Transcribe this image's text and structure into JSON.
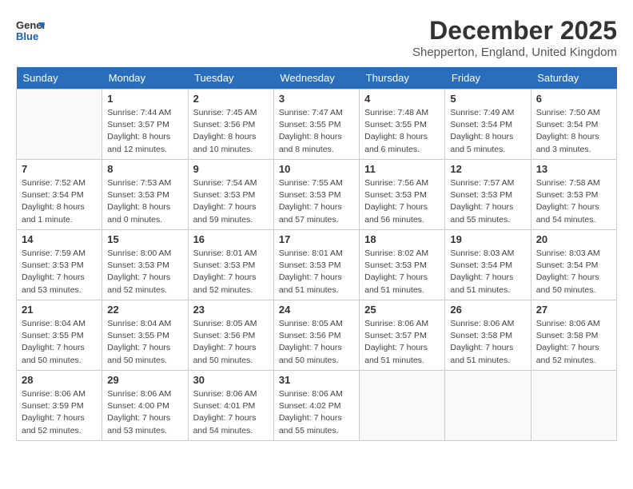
{
  "logo": {
    "text_general": "General",
    "text_blue": "Blue"
  },
  "title": "December 2025",
  "location": "Shepperton, England, United Kingdom",
  "days_header": [
    "Sunday",
    "Monday",
    "Tuesday",
    "Wednesday",
    "Thursday",
    "Friday",
    "Saturday"
  ],
  "weeks": [
    [
      {
        "day": "",
        "sunrise": "",
        "sunset": "",
        "daylight": ""
      },
      {
        "day": "1",
        "sunrise": "Sunrise: 7:44 AM",
        "sunset": "Sunset: 3:57 PM",
        "daylight": "Daylight: 8 hours and 12 minutes."
      },
      {
        "day": "2",
        "sunrise": "Sunrise: 7:45 AM",
        "sunset": "Sunset: 3:56 PM",
        "daylight": "Daylight: 8 hours and 10 minutes."
      },
      {
        "day": "3",
        "sunrise": "Sunrise: 7:47 AM",
        "sunset": "Sunset: 3:55 PM",
        "daylight": "Daylight: 8 hours and 8 minutes."
      },
      {
        "day": "4",
        "sunrise": "Sunrise: 7:48 AM",
        "sunset": "Sunset: 3:55 PM",
        "daylight": "Daylight: 8 hours and 6 minutes."
      },
      {
        "day": "5",
        "sunrise": "Sunrise: 7:49 AM",
        "sunset": "Sunset: 3:54 PM",
        "daylight": "Daylight: 8 hours and 5 minutes."
      },
      {
        "day": "6",
        "sunrise": "Sunrise: 7:50 AM",
        "sunset": "Sunset: 3:54 PM",
        "daylight": "Daylight: 8 hours and 3 minutes."
      }
    ],
    [
      {
        "day": "7",
        "sunrise": "Sunrise: 7:52 AM",
        "sunset": "Sunset: 3:54 PM",
        "daylight": "Daylight: 8 hours and 1 minute."
      },
      {
        "day": "8",
        "sunrise": "Sunrise: 7:53 AM",
        "sunset": "Sunset: 3:53 PM",
        "daylight": "Daylight: 8 hours and 0 minutes."
      },
      {
        "day": "9",
        "sunrise": "Sunrise: 7:54 AM",
        "sunset": "Sunset: 3:53 PM",
        "daylight": "Daylight: 7 hours and 59 minutes."
      },
      {
        "day": "10",
        "sunrise": "Sunrise: 7:55 AM",
        "sunset": "Sunset: 3:53 PM",
        "daylight": "Daylight: 7 hours and 57 minutes."
      },
      {
        "day": "11",
        "sunrise": "Sunrise: 7:56 AM",
        "sunset": "Sunset: 3:53 PM",
        "daylight": "Daylight: 7 hours and 56 minutes."
      },
      {
        "day": "12",
        "sunrise": "Sunrise: 7:57 AM",
        "sunset": "Sunset: 3:53 PM",
        "daylight": "Daylight: 7 hours and 55 minutes."
      },
      {
        "day": "13",
        "sunrise": "Sunrise: 7:58 AM",
        "sunset": "Sunset: 3:53 PM",
        "daylight": "Daylight: 7 hours and 54 minutes."
      }
    ],
    [
      {
        "day": "14",
        "sunrise": "Sunrise: 7:59 AM",
        "sunset": "Sunset: 3:53 PM",
        "daylight": "Daylight: 7 hours and 53 minutes."
      },
      {
        "day": "15",
        "sunrise": "Sunrise: 8:00 AM",
        "sunset": "Sunset: 3:53 PM",
        "daylight": "Daylight: 7 hours and 52 minutes."
      },
      {
        "day": "16",
        "sunrise": "Sunrise: 8:01 AM",
        "sunset": "Sunset: 3:53 PM",
        "daylight": "Daylight: 7 hours and 52 minutes."
      },
      {
        "day": "17",
        "sunrise": "Sunrise: 8:01 AM",
        "sunset": "Sunset: 3:53 PM",
        "daylight": "Daylight: 7 hours and 51 minutes."
      },
      {
        "day": "18",
        "sunrise": "Sunrise: 8:02 AM",
        "sunset": "Sunset: 3:53 PM",
        "daylight": "Daylight: 7 hours and 51 minutes."
      },
      {
        "day": "19",
        "sunrise": "Sunrise: 8:03 AM",
        "sunset": "Sunset: 3:54 PM",
        "daylight": "Daylight: 7 hours and 51 minutes."
      },
      {
        "day": "20",
        "sunrise": "Sunrise: 8:03 AM",
        "sunset": "Sunset: 3:54 PM",
        "daylight": "Daylight: 7 hours and 50 minutes."
      }
    ],
    [
      {
        "day": "21",
        "sunrise": "Sunrise: 8:04 AM",
        "sunset": "Sunset: 3:55 PM",
        "daylight": "Daylight: 7 hours and 50 minutes."
      },
      {
        "day": "22",
        "sunrise": "Sunrise: 8:04 AM",
        "sunset": "Sunset: 3:55 PM",
        "daylight": "Daylight: 7 hours and 50 minutes."
      },
      {
        "day": "23",
        "sunrise": "Sunrise: 8:05 AM",
        "sunset": "Sunset: 3:56 PM",
        "daylight": "Daylight: 7 hours and 50 minutes."
      },
      {
        "day": "24",
        "sunrise": "Sunrise: 8:05 AM",
        "sunset": "Sunset: 3:56 PM",
        "daylight": "Daylight: 7 hours and 50 minutes."
      },
      {
        "day": "25",
        "sunrise": "Sunrise: 8:06 AM",
        "sunset": "Sunset: 3:57 PM",
        "daylight": "Daylight: 7 hours and 51 minutes."
      },
      {
        "day": "26",
        "sunrise": "Sunrise: 8:06 AM",
        "sunset": "Sunset: 3:58 PM",
        "daylight": "Daylight: 7 hours and 51 minutes."
      },
      {
        "day": "27",
        "sunrise": "Sunrise: 8:06 AM",
        "sunset": "Sunset: 3:58 PM",
        "daylight": "Daylight: 7 hours and 52 minutes."
      }
    ],
    [
      {
        "day": "28",
        "sunrise": "Sunrise: 8:06 AM",
        "sunset": "Sunset: 3:59 PM",
        "daylight": "Daylight: 7 hours and 52 minutes."
      },
      {
        "day": "29",
        "sunrise": "Sunrise: 8:06 AM",
        "sunset": "Sunset: 4:00 PM",
        "daylight": "Daylight: 7 hours and 53 minutes."
      },
      {
        "day": "30",
        "sunrise": "Sunrise: 8:06 AM",
        "sunset": "Sunset: 4:01 PM",
        "daylight": "Daylight: 7 hours and 54 minutes."
      },
      {
        "day": "31",
        "sunrise": "Sunrise: 8:06 AM",
        "sunset": "Sunset: 4:02 PM",
        "daylight": "Daylight: 7 hours and 55 minutes."
      },
      {
        "day": "",
        "sunrise": "",
        "sunset": "",
        "daylight": ""
      },
      {
        "day": "",
        "sunrise": "",
        "sunset": "",
        "daylight": ""
      },
      {
        "day": "",
        "sunrise": "",
        "sunset": "",
        "daylight": ""
      }
    ]
  ]
}
